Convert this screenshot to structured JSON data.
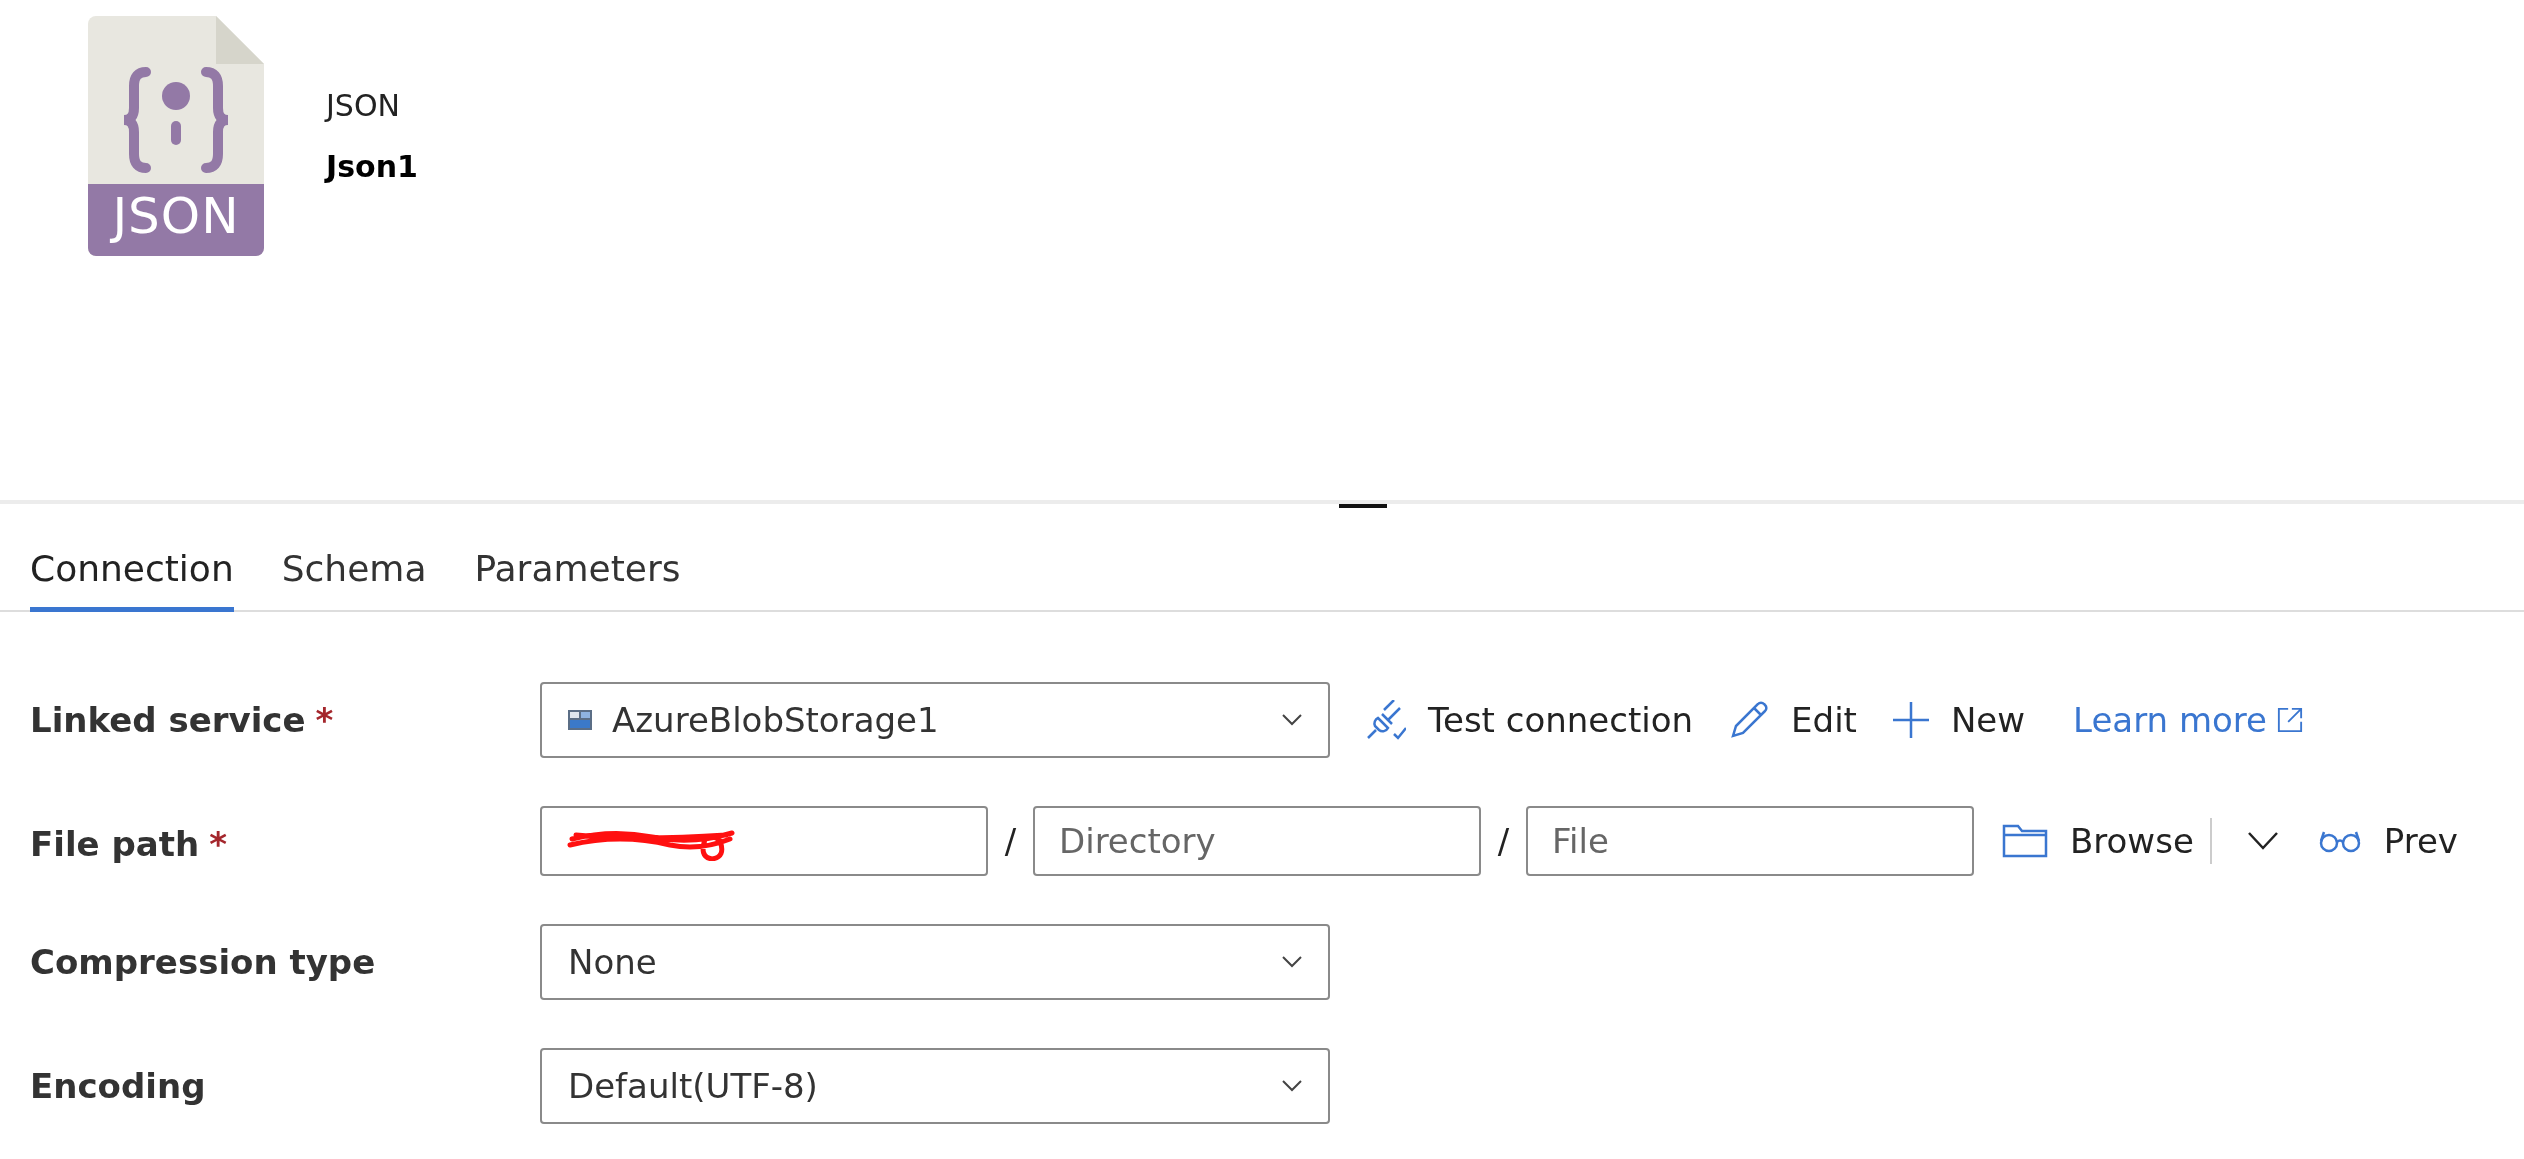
{
  "header": {
    "file_type_badge": "JSON",
    "type": "JSON",
    "name": "Json1"
  },
  "tabs": [
    {
      "label": "Connection",
      "selected": true
    },
    {
      "label": "Schema",
      "selected": false
    },
    {
      "label": "Parameters",
      "selected": false
    }
  ],
  "linked_service": {
    "label": "Linked service",
    "required": "*",
    "value": "AzureBlobStorage1",
    "actions": {
      "test": "Test connection",
      "edit": "Edit",
      "new": "New",
      "learn_more": "Learn more"
    }
  },
  "file_path": {
    "label": "File path",
    "required": "*",
    "container_redacted": true,
    "separators": [
      "/",
      "/"
    ],
    "directory_placeholder": "Directory",
    "file_placeholder": "File",
    "browse": "Browse",
    "preview": "Prev"
  },
  "compression_type": {
    "label": "Compression type",
    "value": "None"
  },
  "encoding": {
    "label": "Encoding",
    "value": "Default(UTF-8)"
  }
}
